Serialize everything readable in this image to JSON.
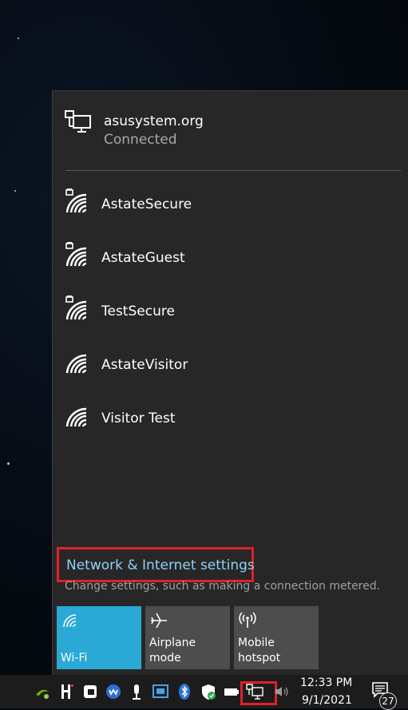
{
  "current_network": {
    "name": "asusystem.org",
    "status": "Connected",
    "icon": "ethernet-pc-icon"
  },
  "networks": [
    {
      "name": "AstateSecure",
      "secured": true
    },
    {
      "name": "AstateGuest",
      "secured": true
    },
    {
      "name": "TestSecure",
      "secured": true
    },
    {
      "name": "AstateVisitor",
      "secured": false
    },
    {
      "name": "Visitor Test",
      "secured": false
    }
  ],
  "settings": {
    "link_label": "Network & Internet settings",
    "description": "Change settings, such as making a connection metered."
  },
  "quick_actions": [
    {
      "label": "Wi-Fi",
      "icon": "wifi-icon",
      "active": true
    },
    {
      "label": "Airplane mode",
      "icon": "airplane-icon",
      "active": false
    },
    {
      "label": "Mobile\nhotspot",
      "icon": "hotspot-icon",
      "active": false
    }
  ],
  "taskbar": {
    "time": "12:33 PM",
    "date": "9/1/2021",
    "notification_count": "27"
  },
  "colors": {
    "accent": "#2aa8d6",
    "highlight": "#e0202a",
    "link": "#8fd0f5",
    "flyout_bg": "#272727"
  }
}
